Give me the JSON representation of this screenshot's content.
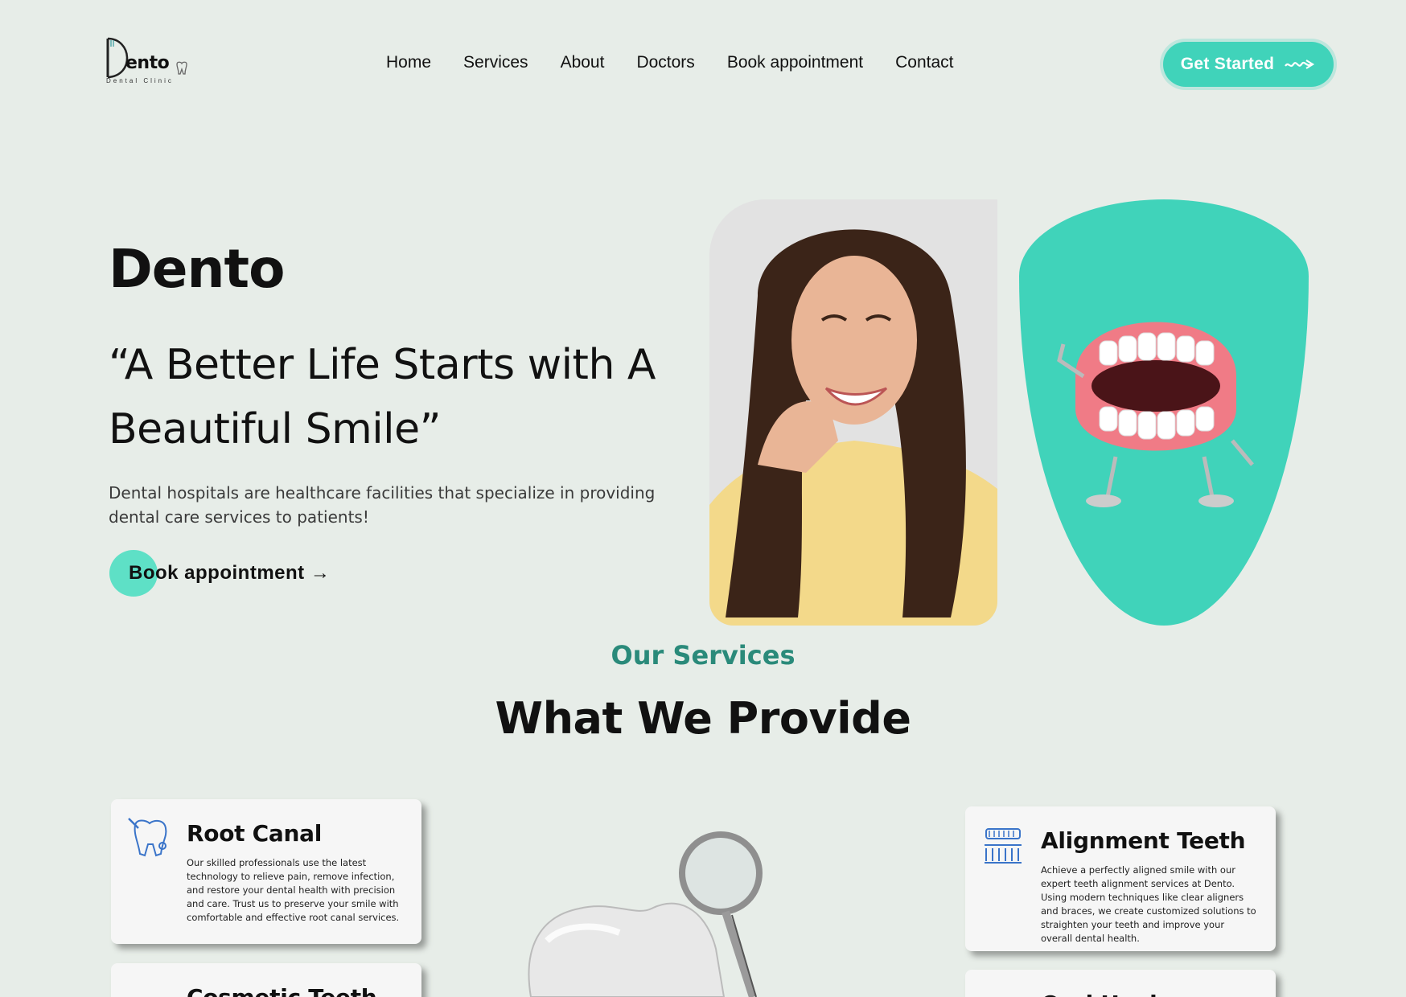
{
  "brand": {
    "name": "Dento",
    "word": "ento",
    "tagline": "Dental Clinic"
  },
  "nav": {
    "items": [
      "Home",
      "Services",
      "About",
      "Doctors",
      "Book appointment",
      "Contact"
    ],
    "cta": "Get Started"
  },
  "hero": {
    "title": "Dento",
    "quote": "“A Better Life Starts with A Beautiful Smile”",
    "description": "Dental hospitals are healthcare facilities that specialize in providing dental care services to patients!",
    "button": "Book appointment →"
  },
  "services": {
    "eyebrow": "Our Services",
    "title": "What We Provide",
    "cards": [
      {
        "title": "Root Canal",
        "icon": "tooth-tool-icon",
        "text": "Our skilled professionals use the latest technology to relieve pain, remove infection, and restore your dental health with precision and care. Trust us to preserve your smile with comfortable and effective root canal services."
      },
      {
        "title": "Alignment Teeth",
        "icon": "braces-icon",
        "text": "Achieve a perfectly aligned smile with our expert teeth alignment services at Dento. Using modern techniques like clear aligners and braces, we create customized solutions to straighten your teeth and improve your overall dental health."
      },
      {
        "title": "Cosmetic Teeth",
        "icon": "teeth-icon",
        "text": ""
      },
      {
        "title": "Oral Hygiene",
        "icon": "toothbrush-icon",
        "text": ""
      }
    ]
  },
  "colors": {
    "accent": "#40d3ba",
    "background": "#e7ede8",
    "eyebrow": "#2a8a7a"
  }
}
